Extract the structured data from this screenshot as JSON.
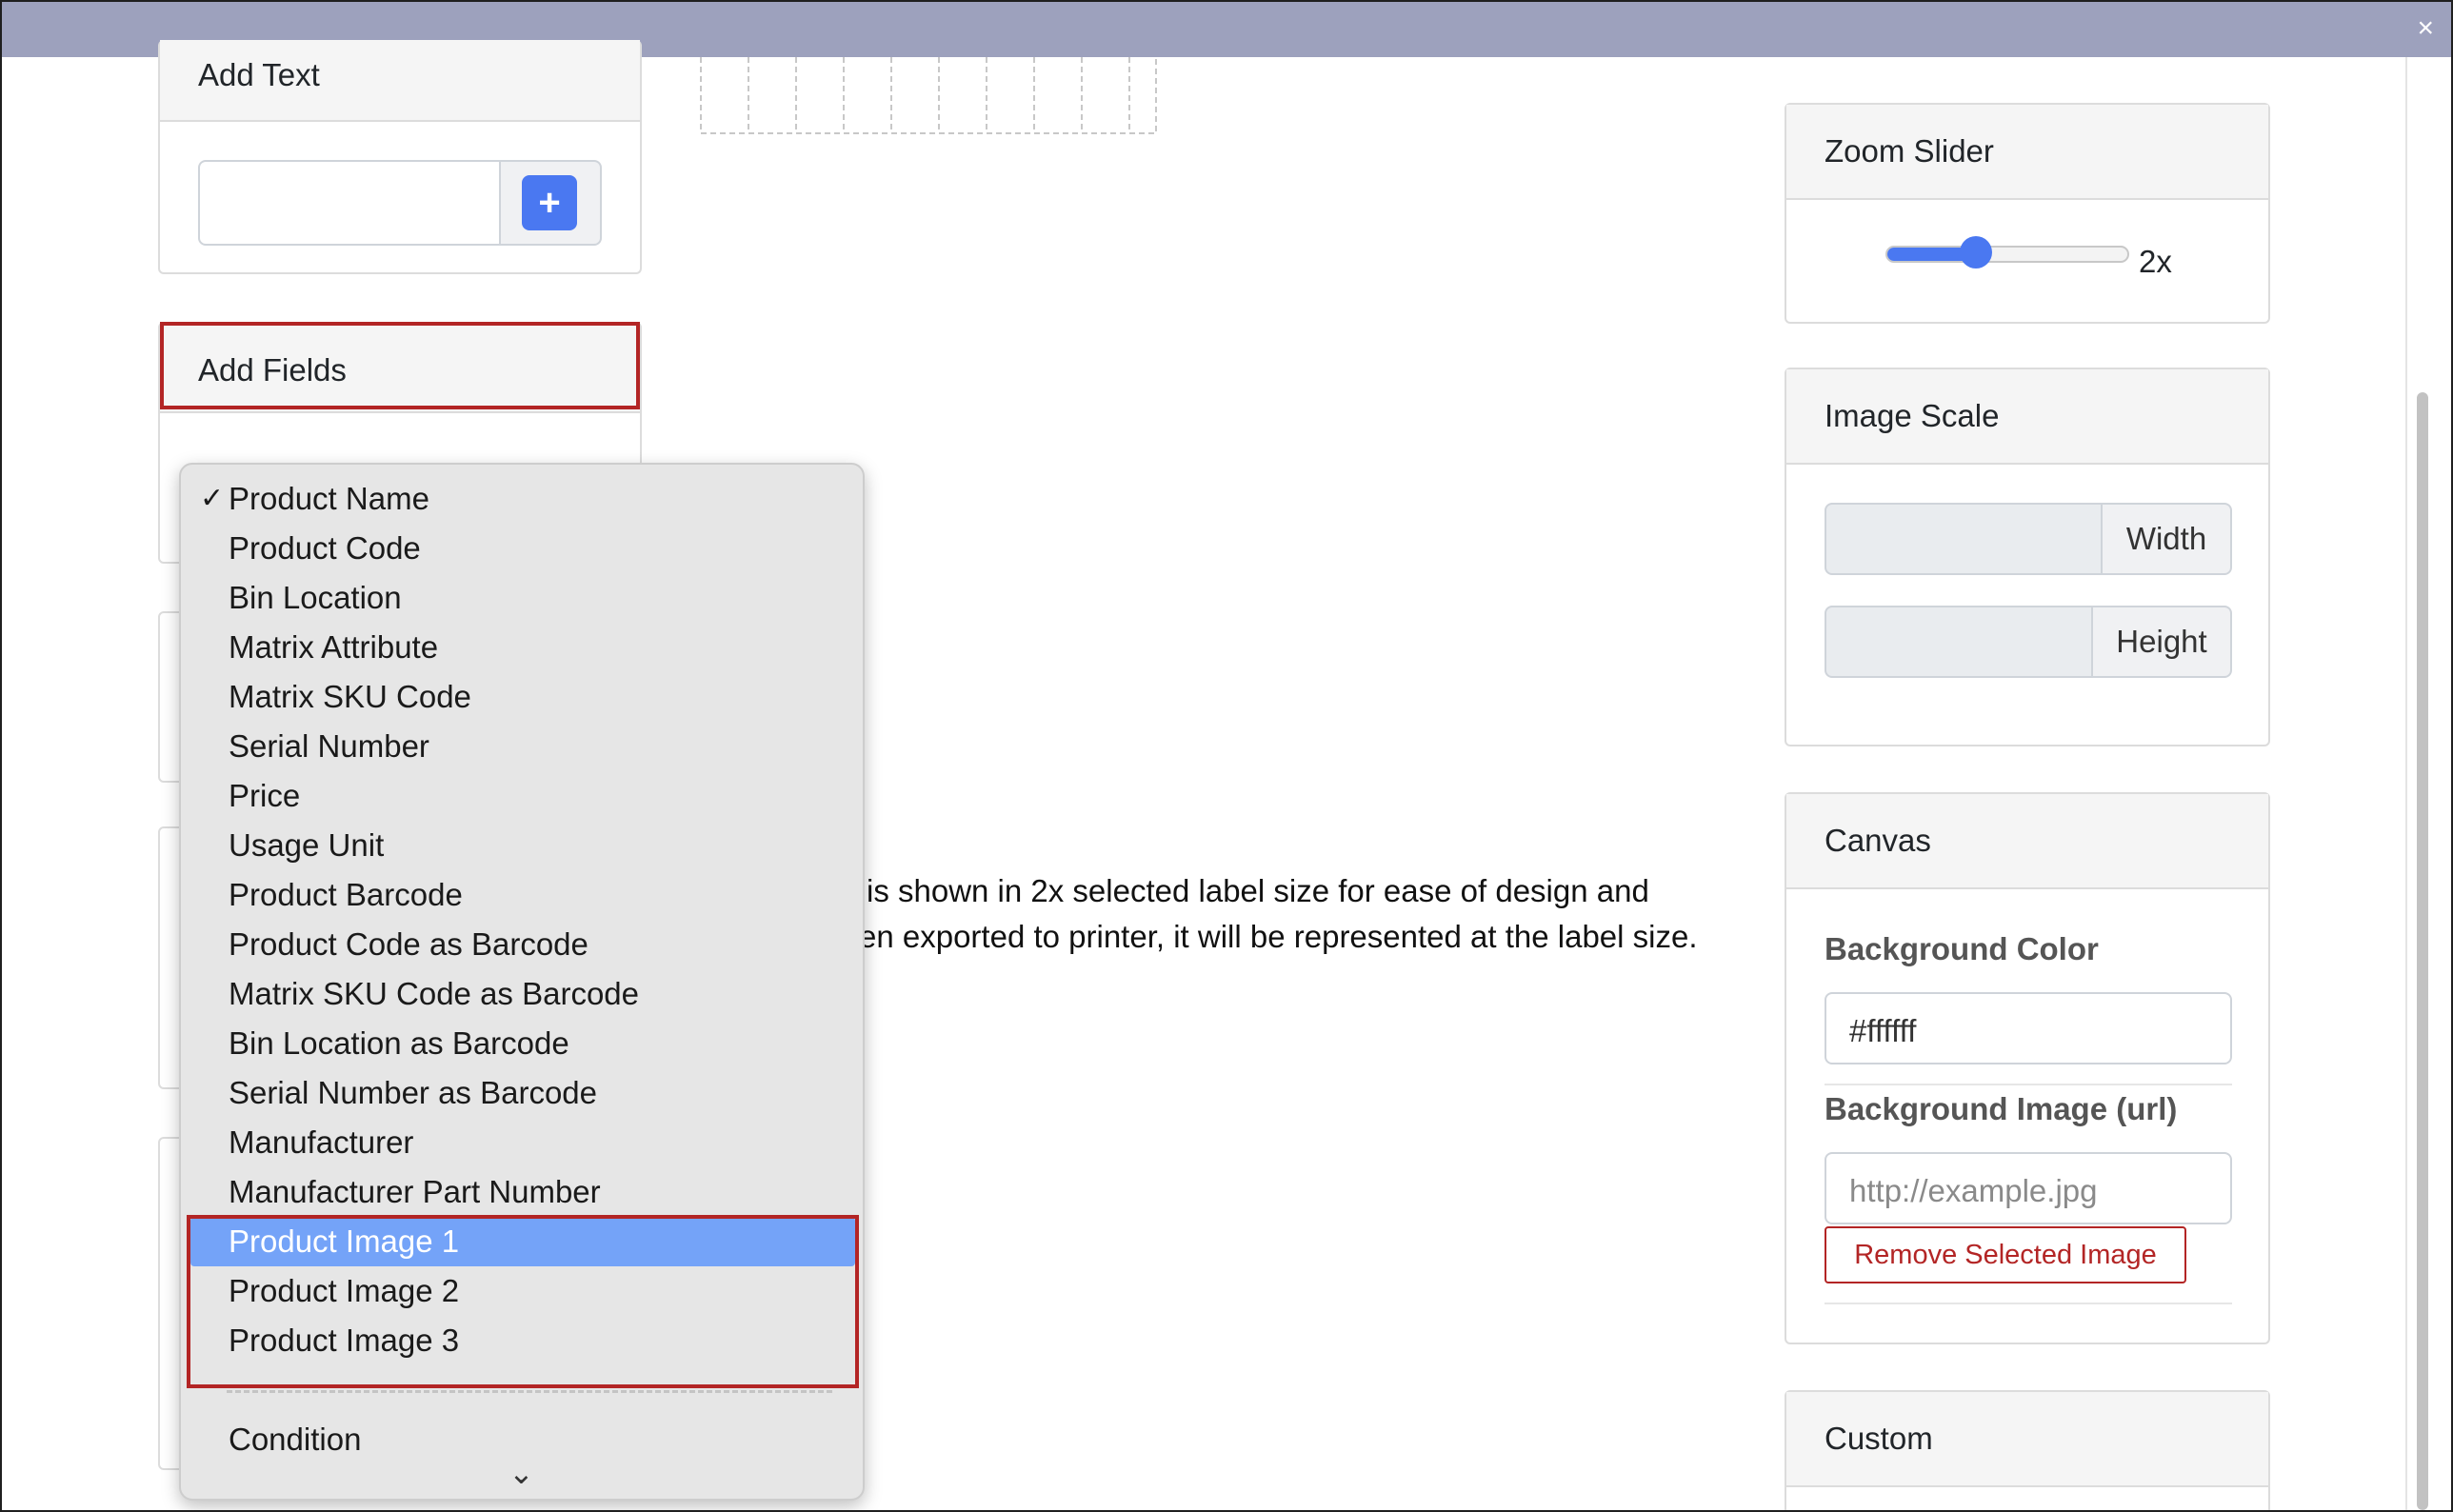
{
  "window": {
    "close_glyph": "×"
  },
  "add_text": {
    "title": "Add Text",
    "add_icon": "plus-icon",
    "plus_glyph": "+"
  },
  "add_fields": {
    "title": "Add Fields"
  },
  "dropdown": {
    "selected_index": 15,
    "check_glyph": "✓",
    "items": [
      "Product Name",
      "Product Code",
      "Bin Location",
      "Matrix Attribute",
      "Matrix SKU Code",
      "Serial Number",
      "Price",
      "Usage Unit",
      "Product Barcode",
      "Product Code as Barcode",
      "Matrix SKU Code as Barcode",
      "Bin Location as Barcode",
      "Serial Number as Barcode",
      "Manufacturer",
      "Manufacturer Part Number",
      "Product Image 1",
      "Product Image 2",
      "Product Image 3"
    ],
    "after_separator": "Condition",
    "more_icon": "chevron-down-icon",
    "more_glyph": "⌄"
  },
  "info": {
    "line1": "is shown in 2x selected label size for ease of design and",
    "line2": "en exported to printer, it will be represented at the label size."
  },
  "zoom": {
    "title": "Zoom Slider",
    "value_label": "2x",
    "level": 0.35
  },
  "image_scale": {
    "title": "Image Scale",
    "width_label": "Width",
    "height_label": "Height"
  },
  "canvas": {
    "title": "Canvas",
    "bg_color_label": "Background Color",
    "bg_color_value": "#ffffff",
    "bg_image_label": "Background Image (url)",
    "bg_image_placeholder": "http://example.jpg",
    "remove_button": "Remove Selected Image"
  },
  "custom": {
    "title": "Custom"
  },
  "colors": {
    "accent": "#4a78f1",
    "selection": "#74a3f8",
    "highlight": "#b32525",
    "danger": "#b32525"
  }
}
